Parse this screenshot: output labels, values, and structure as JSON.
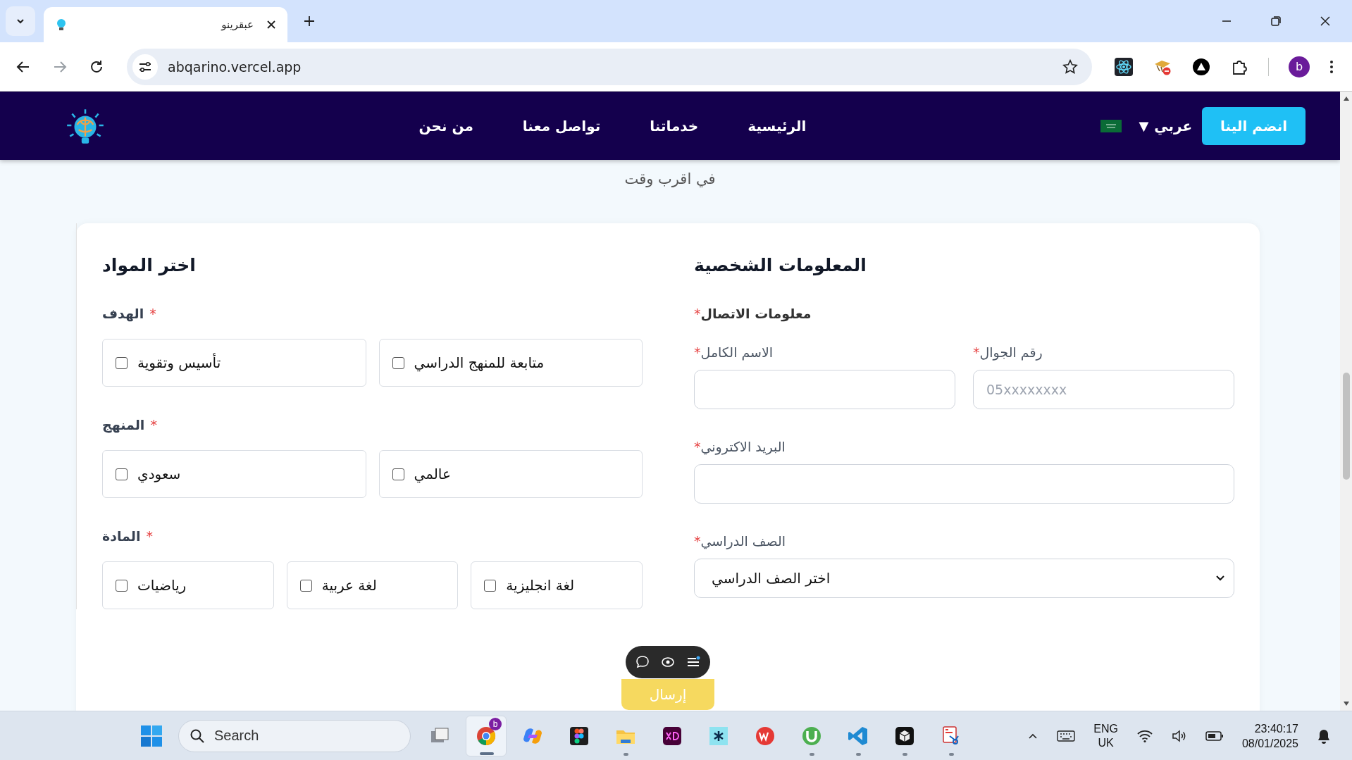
{
  "browser": {
    "tab": {
      "title": "عبقرينو"
    },
    "address": "abqarino.vercel.app",
    "profile": "b"
  },
  "nav": {
    "join_button": "انضم الينا",
    "language": {
      "label": "عربي",
      "arrow": "▼"
    },
    "links": [
      {
        "label": "الرئيسية"
      },
      {
        "label": "خدماتنا"
      },
      {
        "label": "تواصل معنا"
      },
      {
        "label": "من نحن"
      }
    ]
  },
  "intro": "في اقرب وقت",
  "personal": {
    "title": "المعلومات الشخصية",
    "section_label": "معلومات الاتصال",
    "section_required_mark": "*",
    "rows": [
      {
        "fields": [
          {
            "kind": "text",
            "label": "رقم الجوال",
            "required_mark": "*",
            "placeholder": "05xxxxxxxx"
          },
          {
            "kind": "text",
            "label": "الاسم الكامل",
            "required_mark": "*"
          }
        ]
      },
      {
        "fields": [
          {
            "kind": "text",
            "label": "البريد الاكتروني",
            "required_mark": "*"
          }
        ]
      },
      {
        "fields": [
          {
            "kind": "select",
            "label": "الصف الدراسي",
            "required_mark": "*",
            "value": "اختر الصف الدراسي"
          }
        ]
      }
    ]
  },
  "subjects": {
    "title": "اختر المواد",
    "groups": [
      {
        "label": "الهدف",
        "required_mark": "*",
        "options": [
          {
            "label": "متابعة للمنهج الدراسي",
            "checked": false
          },
          {
            "label": "تأسيس وتقوية",
            "checked": false
          }
        ]
      },
      {
        "label": "المنهج",
        "required_mark": "*",
        "options": [
          {
            "label": "عالمي",
            "checked": false
          },
          {
            "label": "سعودي",
            "checked": false
          }
        ]
      },
      {
        "label": "المادة",
        "required_mark": "*",
        "options": [
          {
            "label": "لغة انجليزية",
            "checked": false
          },
          {
            "label": "لغة عربية",
            "checked": false
          },
          {
            "label": "رياضيات",
            "checked": false
          }
        ]
      }
    ]
  },
  "submit_button": "إرسال",
  "taskbar": {
    "search_placeholder": "Search",
    "apps": [
      {
        "kind": "task-view",
        "running": false,
        "selected": false
      },
      {
        "kind": "chrome",
        "running": true,
        "selected": true,
        "badge": "b"
      },
      {
        "kind": "copilot",
        "running": false,
        "selected": false
      },
      {
        "kind": "figma",
        "running": false,
        "selected": false
      },
      {
        "kind": "folder",
        "running": true,
        "selected": false
      },
      {
        "kind": "xd",
        "running": false,
        "selected": false
      },
      {
        "kind": "asterisk",
        "running": false,
        "selected": false
      },
      {
        "kind": "office",
        "running": false,
        "selected": false
      },
      {
        "kind": "torrent",
        "running": true,
        "selected": false
      },
      {
        "kind": "vscode",
        "running": true,
        "selected": false
      },
      {
        "kind": "cube",
        "running": true,
        "selected": false
      },
      {
        "kind": "snip",
        "running": true,
        "selected": false
      }
    ],
    "language": "ENG",
    "region": "UK",
    "time": "23:40:17",
    "date": "08/01/2025"
  }
}
